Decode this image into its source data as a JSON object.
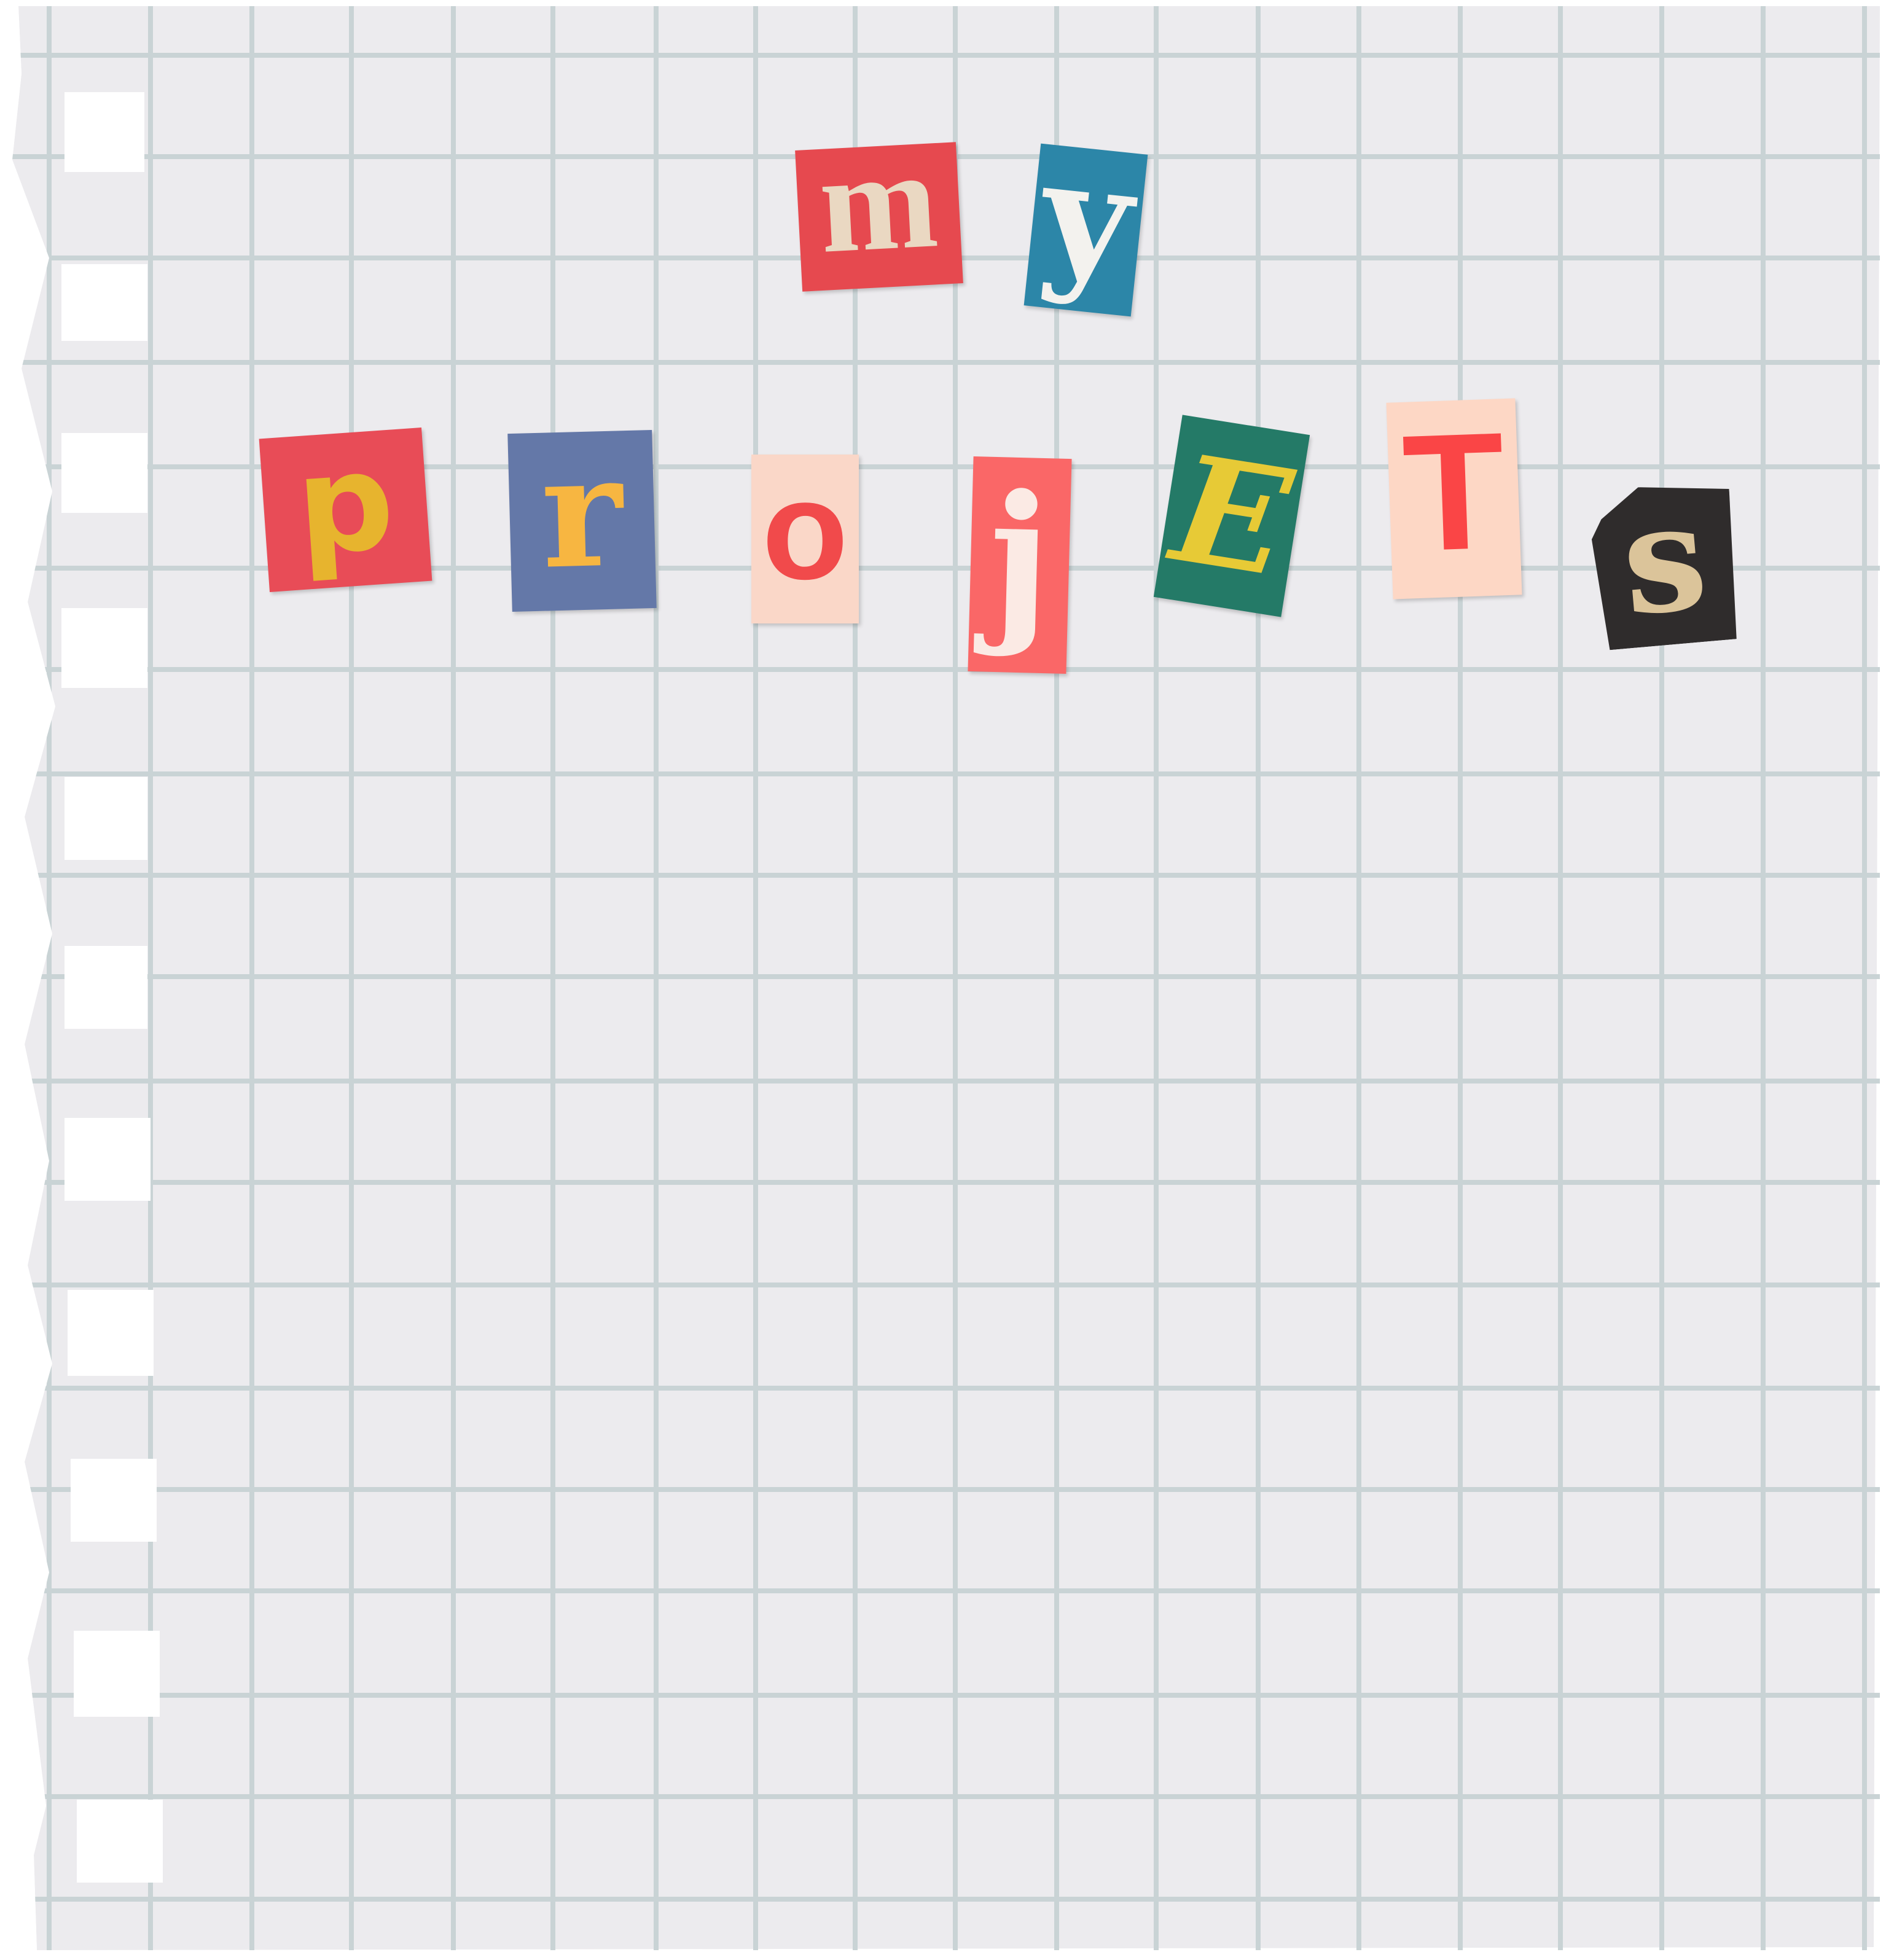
{
  "title": {
    "line1": [
      "m",
      "y"
    ],
    "line2": [
      "p",
      "r",
      "o",
      "j",
      "E",
      "T",
      "s"
    ]
  },
  "colors": {
    "paper": "#ECEBEE",
    "grid": "#C9D3D5",
    "hole": "#FFFFFF",
    "m_bg": "#E6494F",
    "m_fg": "#EAD8C2",
    "y_bg": "#2C86A8",
    "y_fg": "#F3F2EE",
    "p_bg": "#E84C57",
    "p_fg": "#E7B42E",
    "r_bg": "#6478A8",
    "r_fg": "#F7B641",
    "o_bg": "#FAD7C8",
    "o_fg": "#F14A4B",
    "j_bg": "#FA6767",
    "j_fg": "#FBEAE4",
    "E_bg": "#247A67",
    "E_fg": "#E7CA36",
    "T_bg": "#FDD7C5",
    "T_fg": "#FA4546",
    "s_bg": "#2F2C2C",
    "s_fg": "#DBC49A"
  }
}
